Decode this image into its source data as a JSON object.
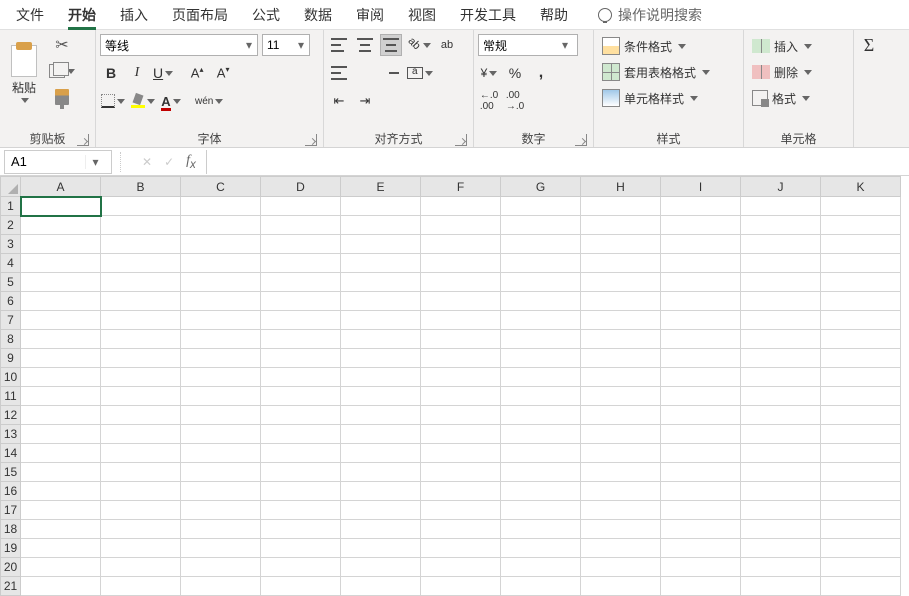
{
  "menu": {
    "file": "文件",
    "home": "开始",
    "insert": "插入",
    "layout": "页面布局",
    "formulas": "公式",
    "data": "数据",
    "review": "审阅",
    "view": "视图",
    "dev": "开发工具",
    "help": "帮助",
    "search_hint": "操作说明搜索"
  },
  "ribbon": {
    "clipboard": {
      "label": "剪贴板",
      "paste": "粘贴"
    },
    "font": {
      "label": "字体",
      "name": "等线",
      "size": "11",
      "pinyin_label": "wén"
    },
    "alignment": {
      "label": "对齐方式",
      "wrap": "ab"
    },
    "number": {
      "label": "数字",
      "format": "常规",
      "inc_dec": ".0",
      "inc_dec2": ".00"
    },
    "styles": {
      "label": "样式",
      "conditional": "条件格式",
      "table_format": "套用表格格式",
      "cell_styles": "单元格样式"
    },
    "cells": {
      "label": "单元格",
      "insert": "插入",
      "delete": "删除",
      "format": "格式"
    }
  },
  "formula_bar": {
    "name_box": "A1",
    "cancel": "✕",
    "enter": "✓"
  },
  "grid": {
    "columns": [
      "A",
      "B",
      "C",
      "D",
      "E",
      "F",
      "G",
      "H",
      "I",
      "J",
      "K"
    ],
    "rows": [
      "1",
      "2",
      "3",
      "4",
      "5",
      "6",
      "7",
      "8",
      "9",
      "10",
      "11",
      "12",
      "13",
      "14",
      "15",
      "16",
      "17",
      "18",
      "19",
      "20",
      "21"
    ],
    "selected": "A1"
  }
}
